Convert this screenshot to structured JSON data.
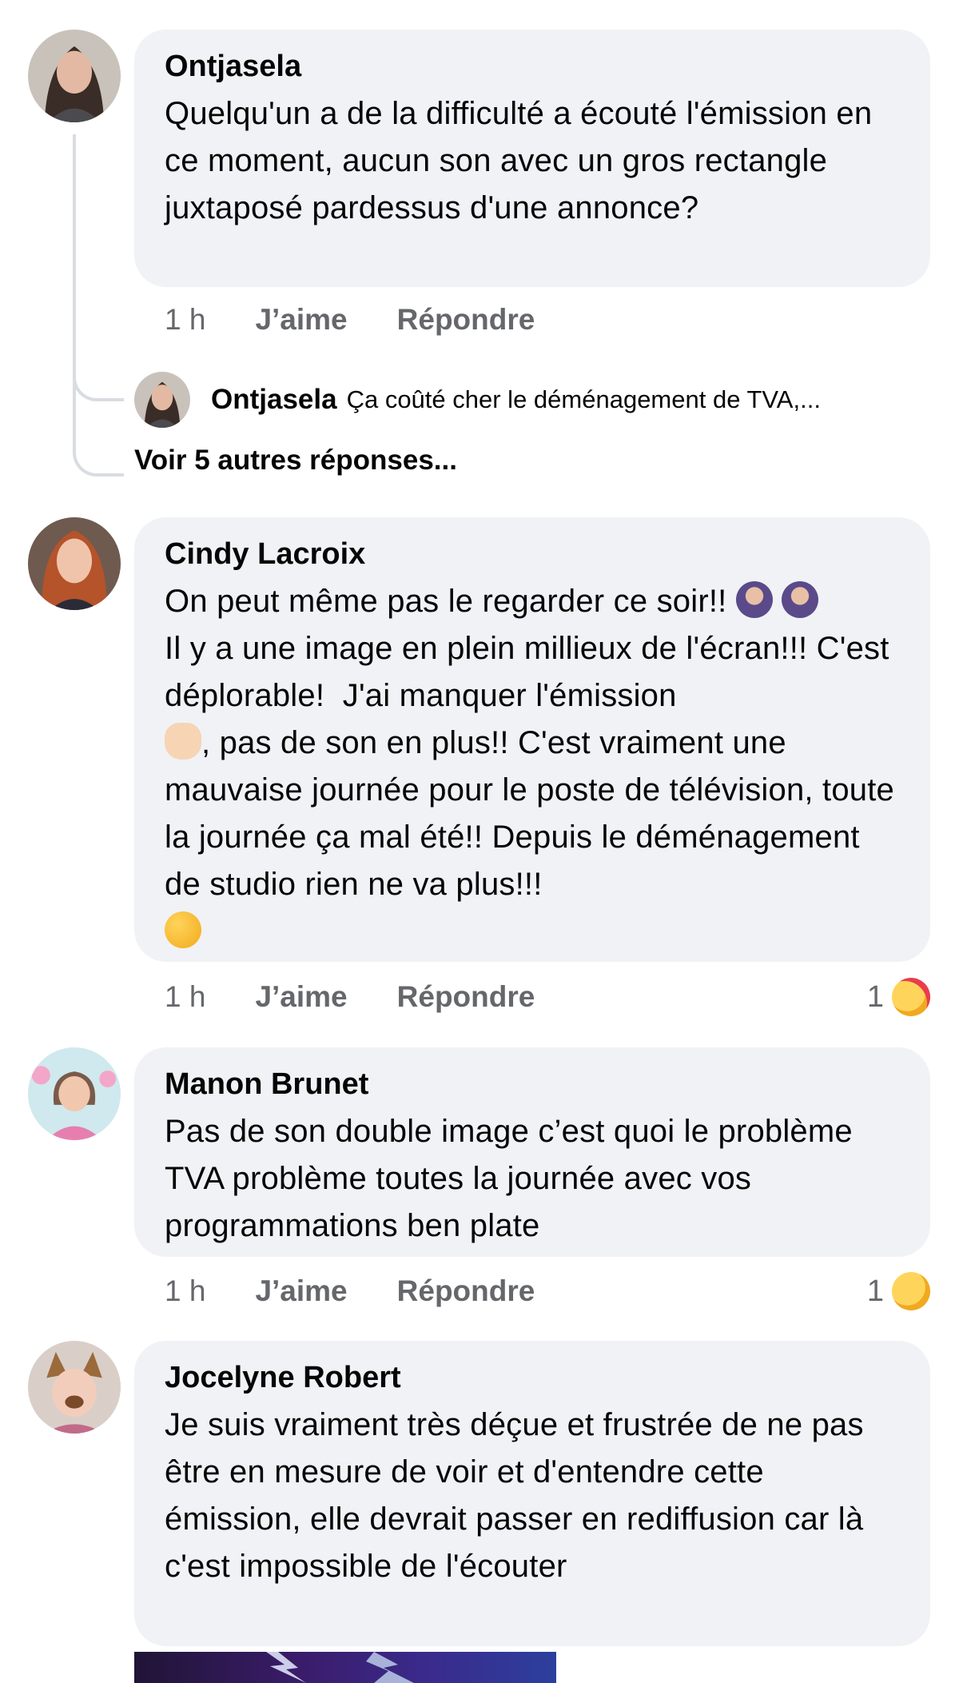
{
  "comments": [
    {
      "author": "Ontjasela",
      "text": "Quelqu'un a de la difficulté a écouté l'émission en ce moment, aucun son avec un gros rectangle juxtaposé pardessus d'une annonce?",
      "time": "1 h",
      "like": "J’aime",
      "reply": "Répondre"
    },
    {
      "author": "Cindy Lacroix",
      "text_1": "On peut même pas le regarder ce soir!!",
      "text_2": "Il y a une image en plein millieux de l'écran!!! C'est déplorable!  J'ai manquer l'émission",
      "text_3": ", pas de son en plus!! C'est vraiment une mauvaise journée pour le poste de télévision, toute la journée ça mal été!! Depuis le déménagement de studio rien ne va plus!!!",
      "time": "1 h",
      "like": "J’aime",
      "reply": "Répondre",
      "reaction_count": "1",
      "reaction_icon": "care-reaction-icon"
    },
    {
      "author": "Manon Brunet",
      "text": "Pas de son double image c’est quoi le problème TVA problème toutes la journée avec vos programmations ben plate",
      "time": "1 h",
      "like": "J’aime",
      "reply": "Répondre",
      "reaction_count": "1",
      "reaction_icon": "sad-reaction-icon"
    },
    {
      "author": "Jocelyne Robert",
      "text": "Je suis vraiment très déçue et frustrée de ne pas être en mesure de voir et d'entendre cette émission, elle devrait passer en rediffusion car là c'est impossible de l'écouter"
    }
  ],
  "reply_preview": {
    "author": "Ontjasela",
    "text": "Ça coûté cher le déménagement de TVA,..."
  },
  "more_replies": "Voir 5 autres réponses...",
  "colors": {
    "bubble": "#f0f2f5",
    "secondary_text": "#65676b",
    "thread_line": "#d9dce1"
  }
}
